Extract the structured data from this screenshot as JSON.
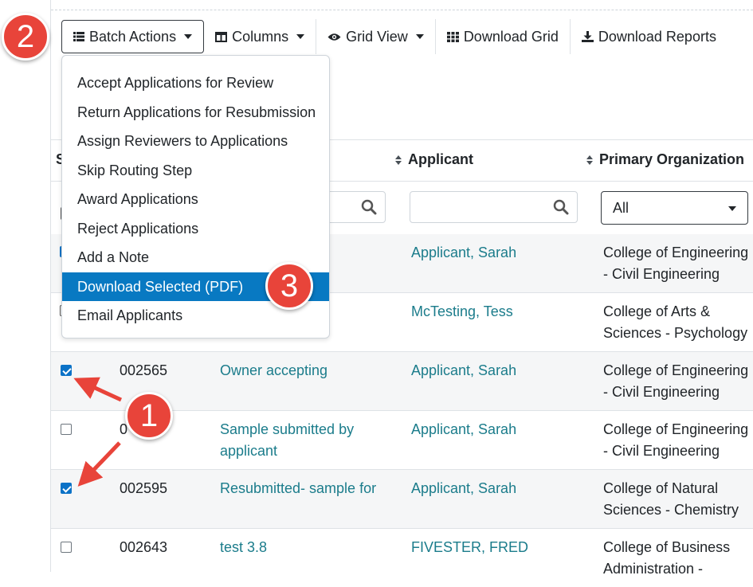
{
  "toolbar": {
    "batch_actions": "Batch Actions",
    "columns": "Columns",
    "grid_view": "Grid View",
    "download_grid": "Download Grid",
    "download_reports": "Download Reports"
  },
  "menu": {
    "items": [
      "Accept Applications for Review",
      "Return Applications for Resubmission",
      "Assign Reviewers to Applications",
      "Skip Routing Step",
      "Award Applications",
      "Reject Applications",
      "Add a Note",
      "Download Selected (PDF)",
      "Email Applicants"
    ],
    "active_index": 7
  },
  "table": {
    "headers": {
      "status_partial": "S",
      "applicant": "Applicant",
      "primary_org": "Primary Organization"
    },
    "org_filter_value": "All",
    "rows": [
      {
        "checked": true,
        "id": "",
        "title": "",
        "applicant": "Applicant, Sarah",
        "org": "College of Engineering - Civil Engineering"
      },
      {
        "checked": false,
        "id": "",
        "title": "",
        "applicant": "McTesting, Tess",
        "org": "College of Arts & Sciences - Psychology"
      },
      {
        "checked": true,
        "id": "002565",
        "title": "Owner accepting",
        "applicant": "Applicant, Sarah",
        "org": "College of Engineering - Civil Engineering"
      },
      {
        "checked": false,
        "id": "0",
        "title": "Sample submitted by applicant",
        "applicant": "Applicant, Sarah",
        "org": "College of Engineering - Civil Engineering"
      },
      {
        "checked": true,
        "id": "002595",
        "title": "Resubmitted- sample for",
        "applicant": "Applicant, Sarah",
        "org": "College of Natural Sciences - Chemistry"
      },
      {
        "checked": false,
        "id": "002643",
        "title": "test 3.8",
        "applicant": "FIVESTER, FRED",
        "org": "College of Business Administration -"
      }
    ]
  },
  "annotations": {
    "badge_1": "1",
    "badge_2": "2",
    "badge_3": "3"
  },
  "colors": {
    "link": "#1b7c8b",
    "menu_active": "#0879c2",
    "badge": "#e8443a",
    "checkbox": "#0b72c7"
  }
}
